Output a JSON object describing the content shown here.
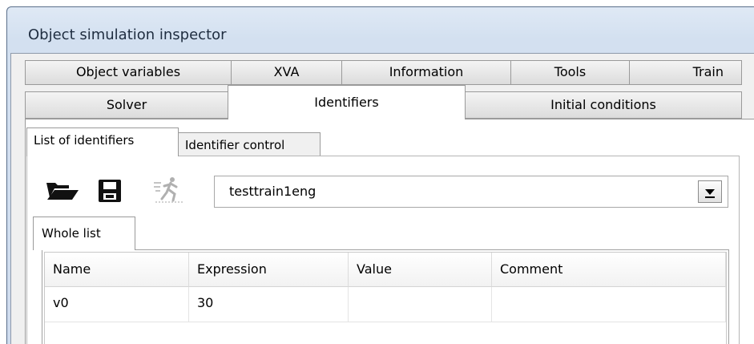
{
  "window": {
    "title": "Object simulation inspector"
  },
  "tabs_row1": [
    {
      "label": "Object variables"
    },
    {
      "label": "XVA"
    },
    {
      "label": "Information"
    },
    {
      "label": "Tools"
    },
    {
      "label": "Train"
    }
  ],
  "tabs_row2": [
    {
      "label": "Solver"
    },
    {
      "label": "Identifiers",
      "active": true
    },
    {
      "label": "Initial conditions"
    }
  ],
  "subtabs": [
    {
      "label": "List of identifiers",
      "active": true
    },
    {
      "label": "Identifier control"
    }
  ],
  "toolbar": {
    "open_icon": "folder-open-icon",
    "save_icon": "save-icon",
    "run_icon": "running-man-icon",
    "combo_value": "testtrain1eng"
  },
  "inner_tab": {
    "label": "Whole list"
  },
  "table": {
    "columns": [
      "Name",
      "Expression",
      "Value",
      "Comment"
    ],
    "rows": [
      [
        "v0",
        "30",
        "",
        ""
      ]
    ]
  }
}
